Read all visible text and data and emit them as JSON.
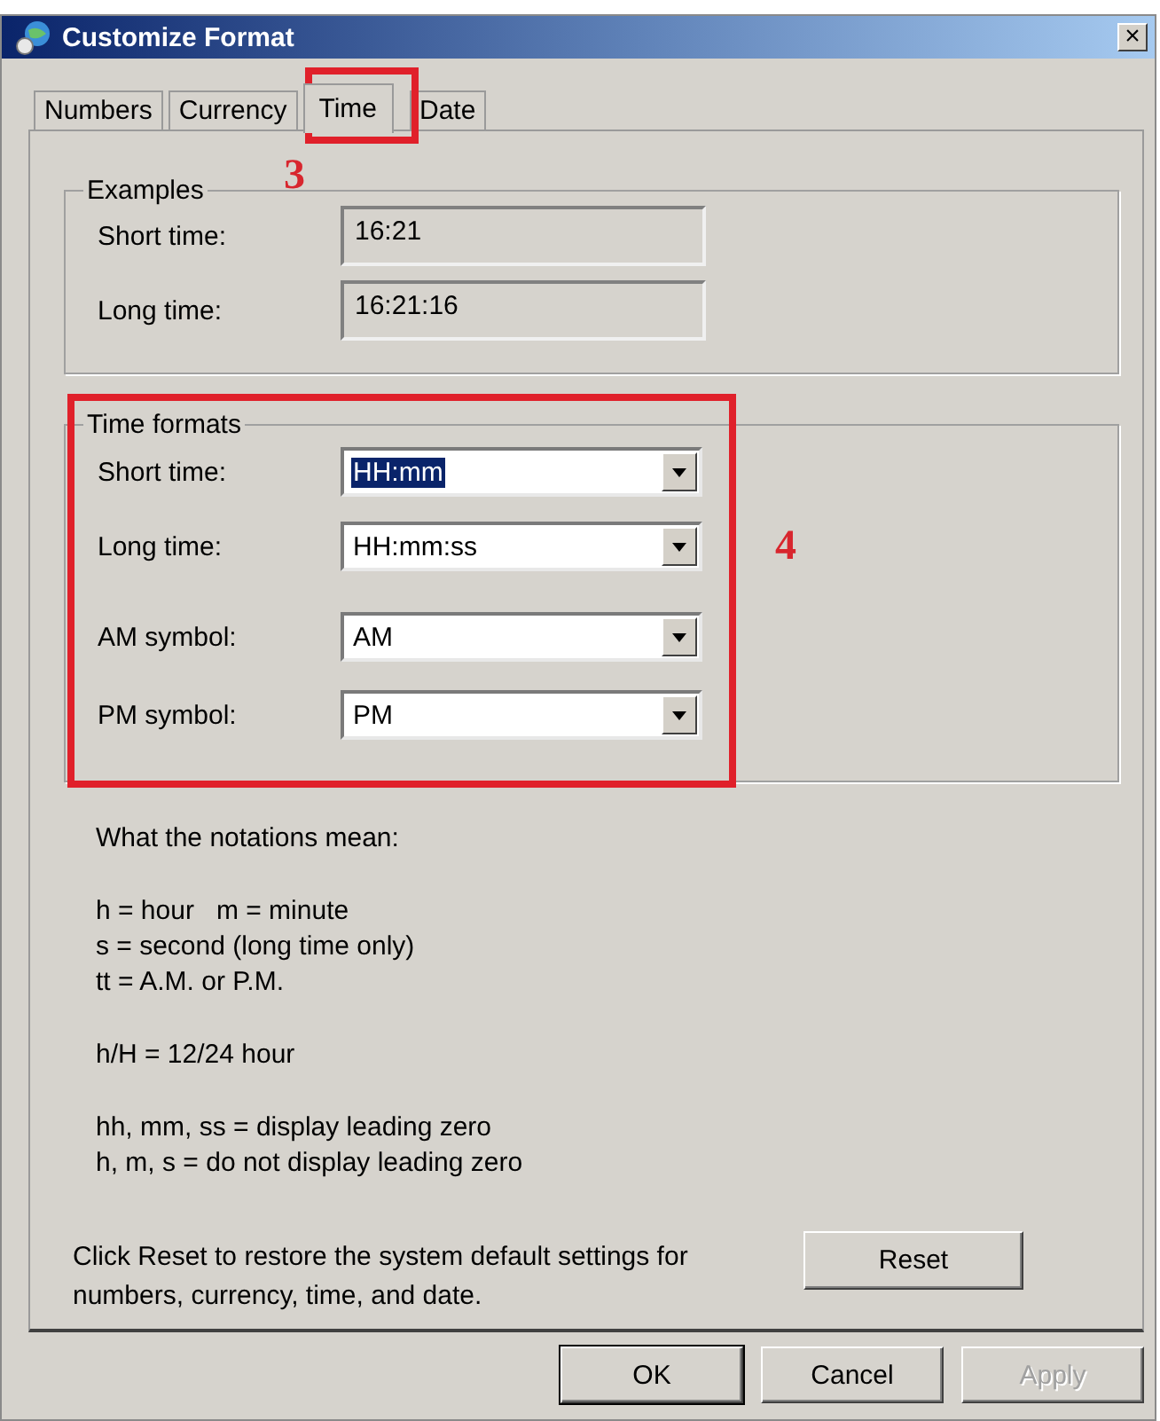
{
  "window": {
    "title": "Customize Format",
    "close": "×"
  },
  "tabs": [
    {
      "label": "Numbers",
      "selected": false
    },
    {
      "label": "Currency",
      "selected": false
    },
    {
      "label": "Time",
      "selected": true
    },
    {
      "label": "Date",
      "selected": false
    }
  ],
  "examples": {
    "legend": "Examples",
    "rows": [
      {
        "label": "Short time:",
        "value": "16:21"
      },
      {
        "label": "Long time:",
        "value": "16:21:16"
      }
    ]
  },
  "time_formats": {
    "legend": "Time formats",
    "rows": [
      {
        "label": "Short time:",
        "value": "HH:mm",
        "highlighted": true
      },
      {
        "label": "Long time:",
        "value": "HH:mm:ss",
        "highlighted": false
      },
      {
        "label": "AM symbol:",
        "value": "AM",
        "highlighted": false
      },
      {
        "label": "PM symbol:",
        "value": "PM",
        "highlighted": false
      }
    ]
  },
  "notes": [
    [
      "What the notations mean:"
    ],
    [
      "h = hour   m = minute",
      "s = second (long time only)",
      "tt = A.M. or P.M."
    ],
    [
      "h/H = 12/24 hour"
    ],
    [
      "hh, mm, ss = display leading zero",
      "h, m, s = do not display leading zero"
    ]
  ],
  "reset_text": "Click Reset to restore the system default settings for numbers, currency, time, and date.",
  "reset_button": "Reset",
  "buttons": [
    {
      "label": "OK",
      "disabled": false,
      "default": true
    },
    {
      "label": "Cancel",
      "disabled": false,
      "default": false
    },
    {
      "label": "Apply",
      "disabled": true,
      "default": false
    }
  ],
  "annotations": [
    {
      "label": "3"
    },
    {
      "label": "4"
    }
  ]
}
